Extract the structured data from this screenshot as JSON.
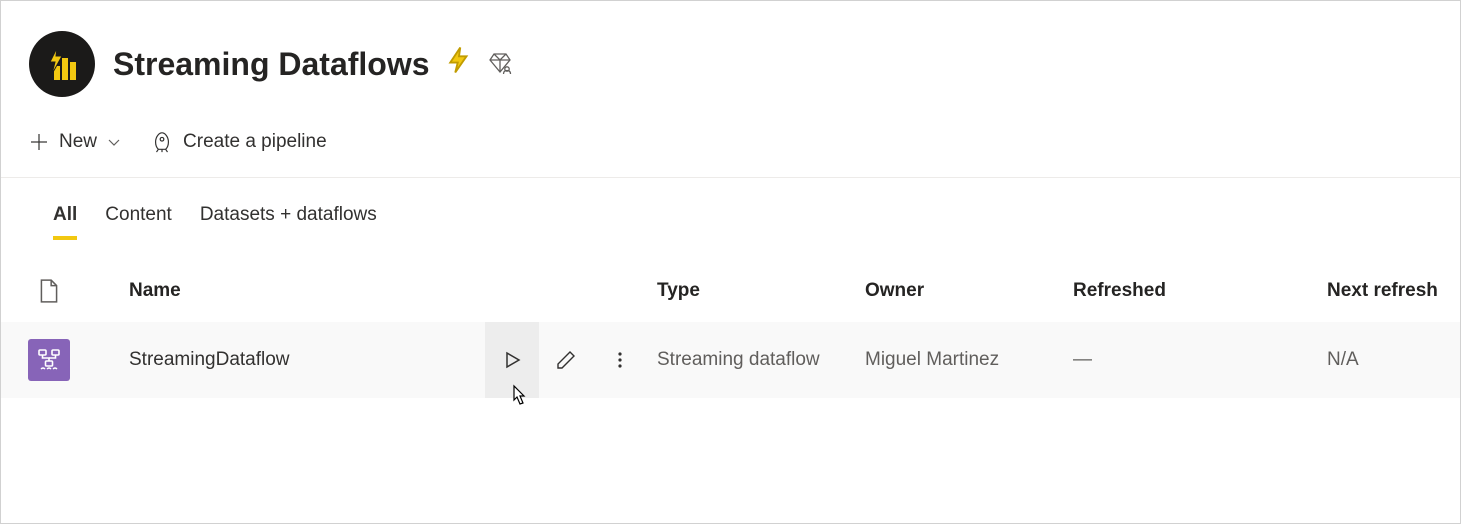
{
  "workspace": {
    "title": "Streaming Dataflows"
  },
  "toolbar": {
    "new_label": "New",
    "pipeline_label": "Create a pipeline"
  },
  "tabs": {
    "all": "All",
    "content": "Content",
    "datasets": "Datasets + dataflows"
  },
  "table": {
    "headers": {
      "name": "Name",
      "type": "Type",
      "owner": "Owner",
      "refreshed": "Refreshed",
      "next": "Next refresh"
    },
    "rows": [
      {
        "name": "StreamingDataflow",
        "type": "Streaming dataflow",
        "owner": "Miguel Martinez",
        "refreshed": "—",
        "next": "N/A"
      }
    ]
  }
}
